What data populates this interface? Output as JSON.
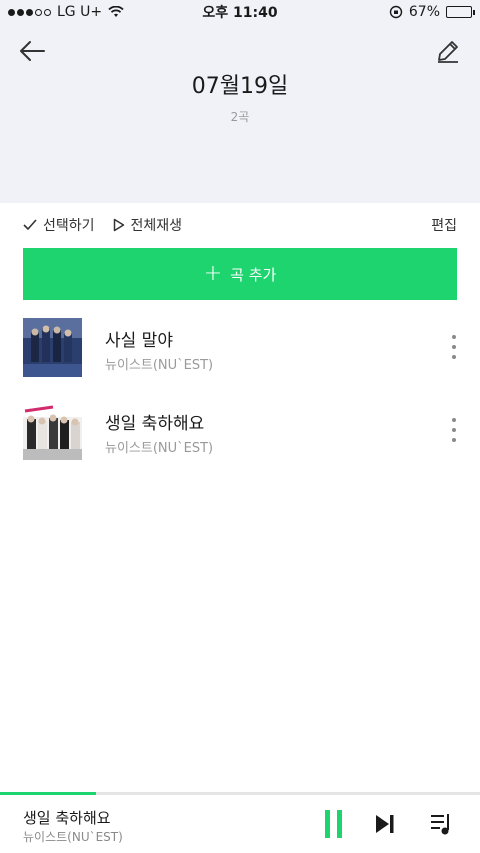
{
  "status_bar": {
    "carrier": "LG U+",
    "time": "오후 11:40",
    "battery": "67%",
    "battery_level": 0.67,
    "signal_bars": 3,
    "signal_total": 5
  },
  "header": {
    "title": "07월19일",
    "count": "2곡"
  },
  "toolbar": {
    "select_label": "선택하기",
    "play_all_label": "전체재생",
    "edit_label": "편집"
  },
  "add_song": {
    "label": "곡 추가"
  },
  "songs": [
    {
      "title": "사실 말야",
      "artist": "뉴이스트(NU`EST)"
    },
    {
      "title": "생일 축하해요",
      "artist": "뉴이스트(NU`EST)"
    }
  ],
  "player": {
    "title": "생일 축하해요",
    "artist": "뉴이스트(NU`EST)",
    "progress": 0.2
  },
  "colors": {
    "accent": "#1dd46f",
    "header_bg": "#f0f2f7"
  },
  "icons": [
    "back-arrow-icon",
    "pencil-icon",
    "check-icon",
    "play-outline-icon",
    "plus-icon",
    "more-vertical-icon",
    "pause-icon",
    "skip-next-icon",
    "queue-list-icon"
  ]
}
